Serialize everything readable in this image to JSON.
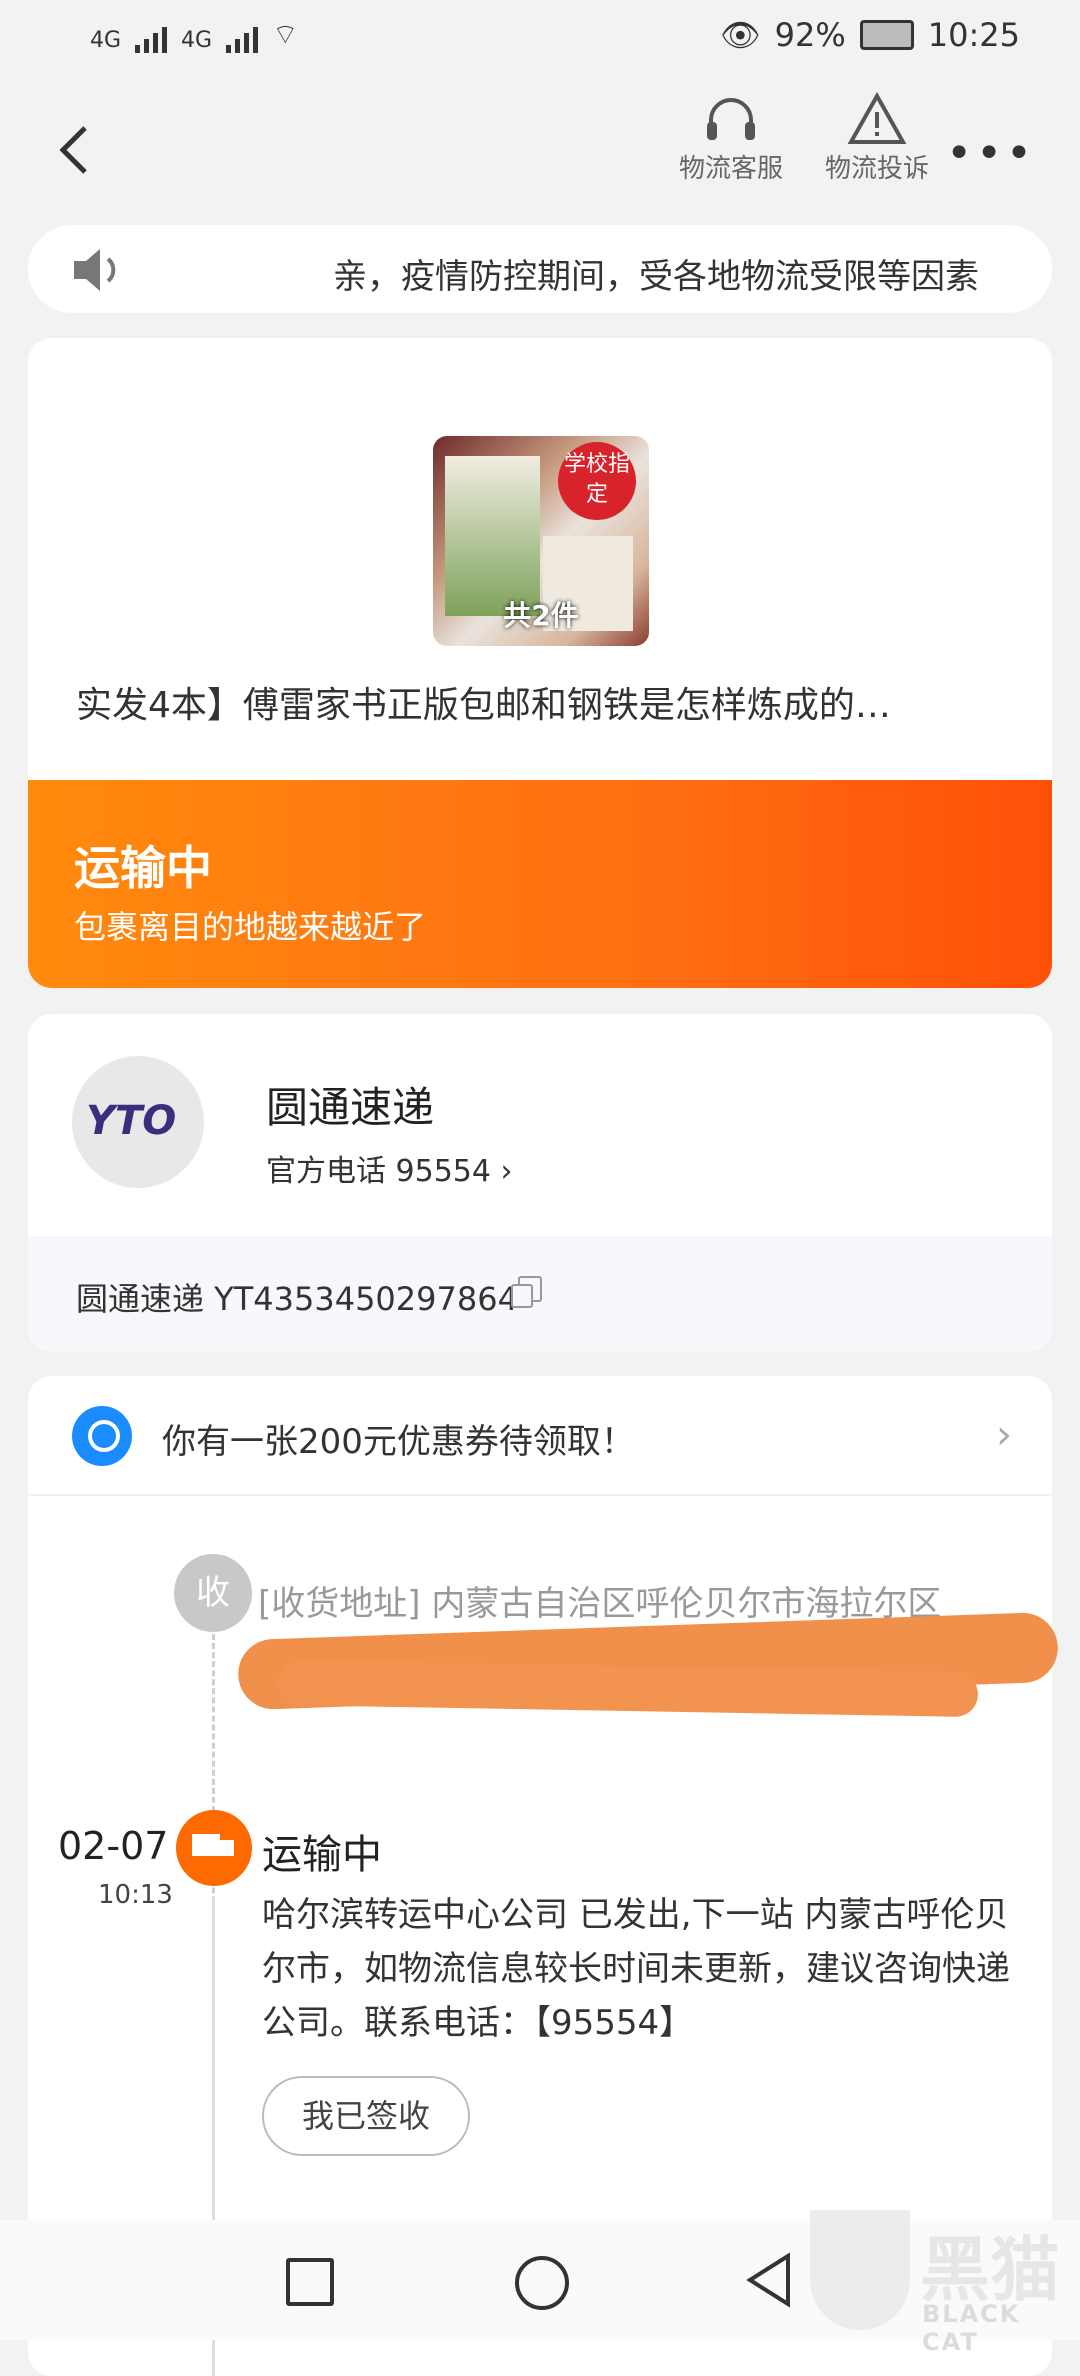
{
  "status_bar": {
    "signal_1": "4G",
    "signal_2": "4G",
    "battery_percent": "92%",
    "time": "10:25"
  },
  "header": {
    "customer_service_label": "物流客服",
    "complaint_label": "物流投诉",
    "more_label": "•••"
  },
  "notice": {
    "text": "亲，疫情防控期间，受各地物流受限等因素"
  },
  "product": {
    "badge": "学校指定",
    "count": "共2件",
    "title": "实发4本】傅雷家书正版包邮和钢铁是怎样炼成的…"
  },
  "shipping_status": {
    "title": "运输中",
    "subtitle": "包裹离目的地越来越近了"
  },
  "courier": {
    "logo_text": "YTO",
    "name": "圆通速递",
    "phone": "官方电话 95554 ›",
    "tracking": "圆通速递 YT4353450297864"
  },
  "coupon": {
    "text": "你有一张200元优惠券待领取！",
    "chevron": "›"
  },
  "timeline": {
    "receive_icon": "收",
    "receive_address": "[收货地址] 内蒙古自治区呼伦贝尔市海拉尔区",
    "events": [
      {
        "date": "02-07",
        "time": "10:13",
        "title": "运输中",
        "desc": "哈尔滨转运中心公司 已发出,下一站 内蒙古呼伦贝尔市，如物流信息较长时间未更新，建议咨询快递公司。联系电话：【95554】"
      }
    ],
    "signed_button": "我已签收"
  },
  "watermark": {
    "cn": "黑猫",
    "en": "BLACK CAT"
  },
  "colors": {
    "accent_orange": "#ff6a00",
    "background": "#f2f2f2",
    "coupon_blue": "#1a8cff"
  }
}
